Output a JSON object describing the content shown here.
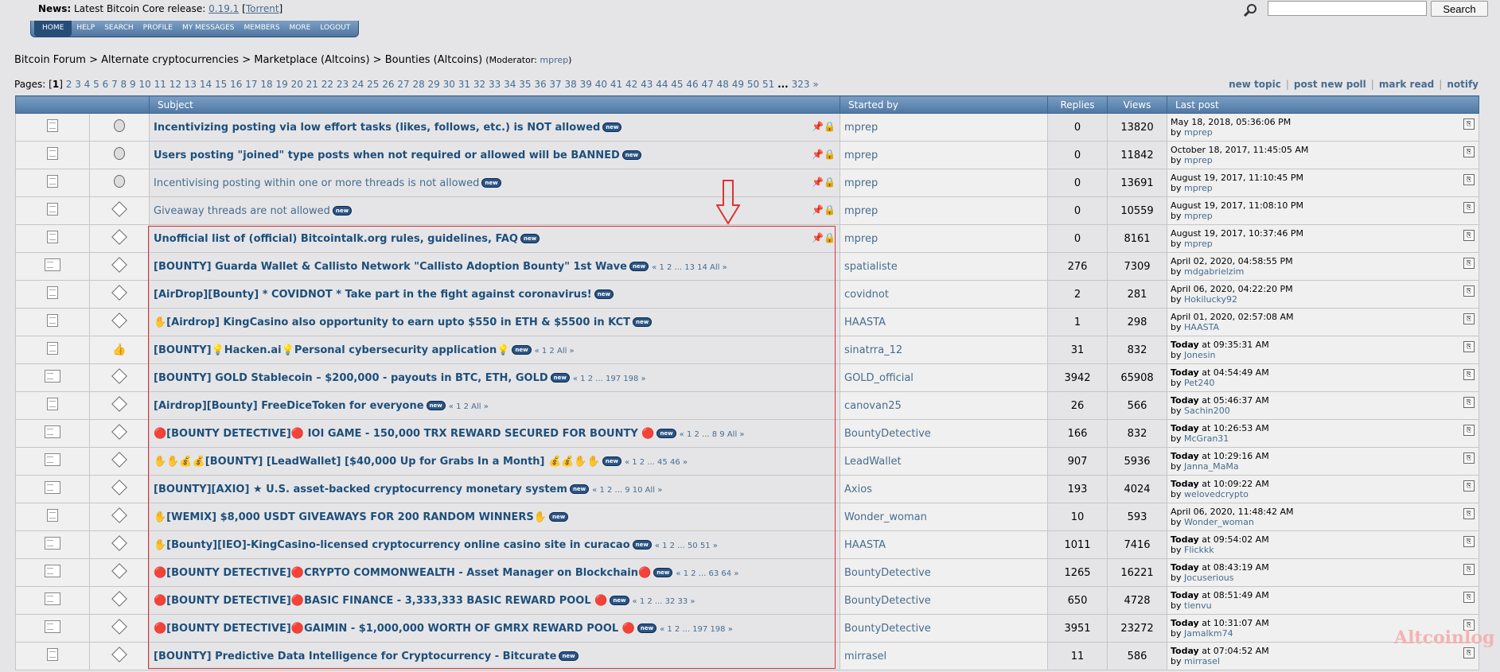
{
  "news": {
    "label": "News:",
    "text": "Latest Bitcoin Core release:",
    "version": "0.19.1",
    "torrent": "Torrent"
  },
  "search": {
    "button": "Search",
    "value": ""
  },
  "nav": [
    "HOME",
    "HELP",
    "SEARCH",
    "PROFILE",
    "MY MESSAGES",
    "MEMBERS",
    "MORE",
    "LOGOUT"
  ],
  "breadcrumb": {
    "items": [
      "Bitcoin Forum",
      "Alternate cryptocurrencies",
      "Marketplace (Altcoins)",
      "Bounties (Altcoins)"
    ],
    "sep": " > ",
    "moderator_label": "(Moderator:",
    "moderator": "mprep"
  },
  "pages": {
    "label": "Pages:",
    "current": "1",
    "list": [
      "2",
      "3",
      "4",
      "5",
      "6",
      "7",
      "8",
      "9",
      "10",
      "11",
      "12",
      "13",
      "14",
      "15",
      "16",
      "17",
      "18",
      "19",
      "20",
      "21",
      "22",
      "23",
      "24",
      "25",
      "26",
      "27",
      "28",
      "29",
      "30",
      "31",
      "32",
      "33",
      "34",
      "35",
      "36",
      "37",
      "38",
      "39",
      "40",
      "41",
      "42",
      "43",
      "44",
      "45",
      "46",
      "47",
      "48",
      "49",
      "50",
      "51"
    ],
    "ellipsis": "...",
    "last": "323",
    "next": "»"
  },
  "actions": [
    "new topic",
    "post new poll",
    "mark read",
    "notify"
  ],
  "columns": {
    "subject": "Subject",
    "started_by": "Started by",
    "replies": "Replies",
    "views": "Views",
    "last_post": "Last post"
  },
  "new_badge": "new",
  "topics": [
    {
      "icon1": "doc",
      "icon2": "circle",
      "title": "Incentivizing posting via low effort tasks (likes, follows, etc.) is NOT allowed",
      "bold": true,
      "pinned": true,
      "pages": "",
      "starter": "mprep",
      "replies": "0",
      "views": "13820",
      "last_date": "May 18, 2018, 05:36:06 PM",
      "last_today": "",
      "last_by": "mprep"
    },
    {
      "icon1": "doc",
      "icon2": "circle",
      "title": "Users posting \"joined\" type posts when not required or allowed will be BANNED",
      "bold": true,
      "pinned": true,
      "pages": "",
      "starter": "mprep",
      "replies": "0",
      "views": "11842",
      "last_date": "October 18, 2017, 11:45:05 AM",
      "last_today": "",
      "last_by": "mprep"
    },
    {
      "icon1": "doc",
      "icon2": "circle",
      "title": "Incentivising posting within one or more threads is not allowed",
      "bold": false,
      "pinned": true,
      "pages": "",
      "starter": "mprep",
      "replies": "0",
      "views": "13691",
      "last_date": "August 19, 2017, 11:10:45 PM",
      "last_today": "",
      "last_by": "mprep"
    },
    {
      "icon1": "doc",
      "icon2": "diamond",
      "title": "Giveaway threads are not allowed",
      "bold": false,
      "pinned": true,
      "pages": "",
      "starter": "mprep",
      "replies": "0",
      "views": "10559",
      "last_date": "August 19, 2017, 11:08:10 PM",
      "last_today": "",
      "last_by": "mprep"
    },
    {
      "icon1": "doc",
      "icon2": "diamond",
      "title": "Unofficial list of (official) Bitcointalk.org rules, guidelines, FAQ",
      "bold": true,
      "pinned": true,
      "pages": "",
      "starter": "mprep",
      "replies": "0",
      "views": "8161",
      "last_date": "August 19, 2017, 10:37:46 PM",
      "last_today": "",
      "last_by": "mprep"
    },
    {
      "icon1": "hot",
      "icon2": "diamond",
      "title": "[BOUNTY] Guarda Wallet & Callisto Network \"Callisto Adoption Bounty\" 1st Wave",
      "bold": true,
      "pinned": false,
      "pages": "« 1 2 ... 13 14  All »",
      "starter": "spatialiste",
      "replies": "276",
      "views": "7309",
      "last_date": "April 02, 2020, 04:58:55 PM",
      "last_today": "",
      "last_by": "mdgabrielzim"
    },
    {
      "icon1": "doc",
      "icon2": "diamond",
      "title": "[AirDrop][Bounty] * COVIDNOT * Take part in the fight against coronavirus!",
      "bold": true,
      "pinned": false,
      "pages": "",
      "starter": "covidnot",
      "replies": "2",
      "views": "281",
      "last_date": "April 06, 2020, 04:22:20 PM",
      "last_today": "",
      "last_by": "Hokilucky92"
    },
    {
      "icon1": "doc",
      "icon2": "diamond",
      "title": "✋[Airdrop] KingCasino also opportunity to earn upto $550 in ETH & $5500 in KCT",
      "bold": true,
      "pinned": false,
      "pages": "",
      "starter": "HAASTA",
      "replies": "1",
      "views": "298",
      "last_date": "April 01, 2020, 02:57:08 AM",
      "last_today": "",
      "last_by": "HAASTA"
    },
    {
      "icon1": "doc",
      "icon2": "thumb",
      "title": "[BOUNTY]💡Hacken.ai💡Personal cybersecurity application💡",
      "bold": true,
      "pinned": false,
      "pages": "« 1 2  All »",
      "starter": "sinatrra_12",
      "replies": "31",
      "views": "832",
      "last_date": "",
      "last_today": "at 09:35:31 AM",
      "last_by": "Jonesin"
    },
    {
      "icon1": "hot",
      "icon2": "diamond",
      "title": "[BOUNTY] GOLD Stablecoin – $200,000 - payouts in BTC, ETH, GOLD",
      "bold": true,
      "pinned": false,
      "pages": "« 1 2 ... 197 198 »",
      "starter": "GOLD_official",
      "replies": "3942",
      "views": "65908",
      "last_date": "",
      "last_today": "at 04:54:49 AM",
      "last_by": "Pet240"
    },
    {
      "icon1": "doc",
      "icon2": "diamond",
      "title": "[Airdrop][Bounty] FreeDiceToken for everyone",
      "bold": true,
      "pinned": false,
      "pages": "« 1 2  All »",
      "starter": "canovan25",
      "replies": "26",
      "views": "566",
      "last_date": "",
      "last_today": "at 05:46:37 AM",
      "last_by": "Sachin200"
    },
    {
      "icon1": "hot",
      "icon2": "diamond",
      "title": "🔴[BOUNTY DETECTIVE]🔴 IOI GAME - 150,000 TRX REWARD SECURED FOR BOUNTY 🔴",
      "bold": true,
      "pinned": false,
      "pages": "« 1 2 ... 8 9  All »",
      "starter": "BountyDetective",
      "replies": "166",
      "views": "832",
      "last_date": "",
      "last_today": "at 10:26:53 AM",
      "last_by": "McGran31"
    },
    {
      "icon1": "hot",
      "icon2": "diamond",
      "title": "✋✋💰💰[BOUNTY] [LeadWallet] [$40,000 Up for Grabs In a Month] 💰💰✋✋",
      "bold": true,
      "pinned": false,
      "pages": "« 1 2 ... 45 46 »",
      "starter": "LeadWallet",
      "replies": "907",
      "views": "5936",
      "last_date": "",
      "last_today": "at 10:29:16 AM",
      "last_by": "Janna_MaMa"
    },
    {
      "icon1": "hot",
      "icon2": "diamond",
      "title": "[BOUNTY][AXIO] ★ U.S. asset-backed cryptocurrency monetary system",
      "bold": true,
      "pinned": false,
      "pages": "« 1 2 ... 9 10  All »",
      "starter": "Axios",
      "replies": "193",
      "views": "4024",
      "last_date": "",
      "last_today": "at 10:09:22 AM",
      "last_by": "welovedcrypto"
    },
    {
      "icon1": "doc",
      "icon2": "diamond",
      "title": "✋[WEMIX] $8,000 USDT GIVEAWAYS FOR 200 RANDOM WINNERS✋",
      "bold": true,
      "pinned": false,
      "pages": "",
      "starter": "Wonder_woman",
      "replies": "10",
      "views": "593",
      "last_date": "April 06, 2020, 11:48:42 AM",
      "last_today": "",
      "last_by": "Wonder_woman"
    },
    {
      "icon1": "hot",
      "icon2": "diamond",
      "title": "✋[Bounty][IEO]-KingCasino-licensed cryptocurrency online casino site in curacao",
      "bold": true,
      "pinned": false,
      "pages": "« 1 2 ... 50 51 »",
      "starter": "HAASTA",
      "replies": "1011",
      "views": "7416",
      "last_date": "",
      "last_today": "at 09:54:02 AM",
      "last_by": "Flickkk"
    },
    {
      "icon1": "hot",
      "icon2": "diamond",
      "title": "🔴[BOUNTY DETECTIVE]🔴CRYPTO COMMONWEALTH - Asset Manager on Blockchain🔴",
      "bold": true,
      "pinned": false,
      "pages": "« 1 2 ... 63 64 »",
      "starter": "BountyDetective",
      "replies": "1265",
      "views": "16221",
      "last_date": "",
      "last_today": "at 08:43:19 AM",
      "last_by": "Jocuserious"
    },
    {
      "icon1": "hot",
      "icon2": "diamond",
      "title": "🔴[BOUNTY DETECTIVE]🔴BASIC FINANCE - 3,333,333 BASIC REWARD POOL 🔴",
      "bold": true,
      "pinned": false,
      "pages": "« 1 2 ... 32 33 »",
      "starter": "BountyDetective",
      "replies": "650",
      "views": "4728",
      "last_date": "",
      "last_today": "at 08:51:49 AM",
      "last_by": "tienvu"
    },
    {
      "icon1": "hot",
      "icon2": "diamond",
      "title": "🔴[BOUNTY DETECTIVE]🔴GAIMIN - $1,000,000 WORTH OF GMRX REWARD POOL 🔴",
      "bold": true,
      "pinned": false,
      "pages": "« 1 2 ... 197 198 »",
      "starter": "BountyDetective",
      "replies": "3951",
      "views": "23272",
      "last_date": "",
      "last_today": "at 10:31:07 AM",
      "last_by": "Jamalkm74"
    },
    {
      "icon1": "doc",
      "icon2": "diamond",
      "title": "[BOUNTY] Predictive Data Intelligence for Cryptocurrency - Bitcurate",
      "bold": true,
      "pinned": false,
      "pages": "",
      "starter": "mirrasel",
      "replies": "11",
      "views": "586",
      "last_date": "",
      "last_today": "at 07:04:52 AM",
      "last_by": "mirrasel"
    }
  ],
  "today_label": "Today",
  "by_label": "by",
  "watermark": "Altcoinlog"
}
